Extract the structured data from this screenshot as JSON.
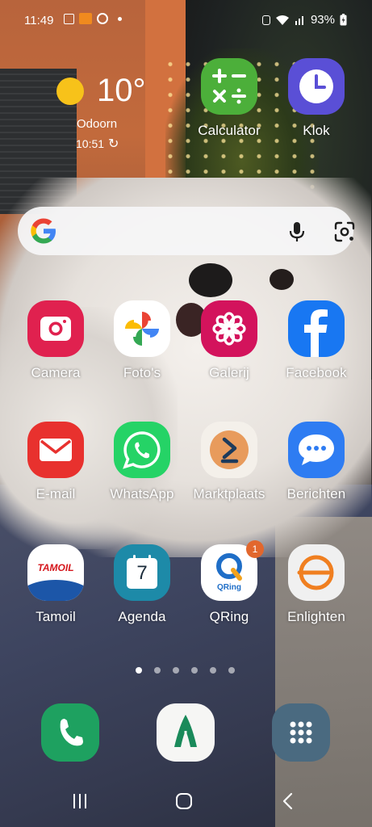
{
  "status_bar": {
    "time": "11:49",
    "battery": "93%"
  },
  "weather": {
    "temperature": "10°",
    "location": "Odoorn",
    "updated": "10:51"
  },
  "search": {
    "placeholder": ""
  },
  "apps": [
    {
      "label": "Calculator",
      "icon": "calculator-icon"
    },
    {
      "label": "Klok",
      "icon": "clock-icon"
    },
    {
      "label": "Camera",
      "icon": "camera-icon"
    },
    {
      "label": "Foto's",
      "icon": "photos-pinwheel-icon"
    },
    {
      "label": "Galerij",
      "icon": "gallery-flower-icon"
    },
    {
      "label": "Facebook",
      "icon": "facebook-icon"
    },
    {
      "label": "E-mail",
      "icon": "email-icon"
    },
    {
      "label": "WhatsApp",
      "icon": "whatsapp-icon"
    },
    {
      "label": "Marktplaats",
      "icon": "marktplaats-icon"
    },
    {
      "label": "Berichten",
      "icon": "messages-icon"
    },
    {
      "label": "Tamoil",
      "icon": "tamoil-icon",
      "logo_text": "TAMOIL"
    },
    {
      "label": "Agenda",
      "icon": "calendar-icon",
      "day": "7"
    },
    {
      "label": "QRing",
      "icon": "qring-icon",
      "logo_text": "QRing",
      "badge": "1"
    },
    {
      "label": "Enlighten",
      "icon": "enlighten-icon"
    }
  ],
  "pager": {
    "pages": 6,
    "current": 1
  },
  "dock": [
    {
      "icon": "phone-icon"
    },
    {
      "icon": "tulip-app-icon"
    },
    {
      "icon": "app-drawer-icon"
    }
  ],
  "nav": [
    "recents-icon",
    "home-icon",
    "back-icon"
  ],
  "colors": {
    "sun": "#f7c21a",
    "calculator": "#4caf3a",
    "clock": "#5a4fd6",
    "camera": "#e0214f",
    "gallery": "#d3135c",
    "facebook": "#1877f2",
    "email": "#e8312e",
    "whatsapp": "#25d366",
    "marktplaats": "#f4f0ea",
    "messages": "#2e7cf2",
    "calendar": "#1d8aa8",
    "enlighten": "#f0f0f0",
    "phone": "#1ea160",
    "drawer": "#4a6a80",
    "badge": "#e2672d"
  }
}
